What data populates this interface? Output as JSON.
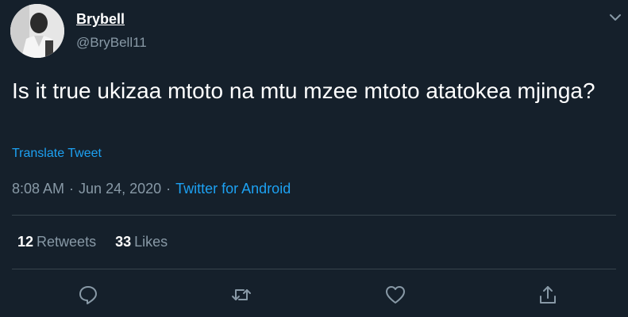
{
  "tweet": {
    "author": {
      "name": "Brybell",
      "handle": "@BryBell11",
      "avatar_icon": "profile-photo"
    },
    "text": "Is it true ukizaa mtoto na mtu mzee mtoto atatokea mjinga?",
    "translate_label": "Translate Tweet",
    "time": "8:08 AM",
    "date": "Jun 24, 2020",
    "separator": "·",
    "source": "Twitter for Android",
    "retweets": {
      "count": "12",
      "label": "Retweets"
    },
    "likes": {
      "count": "33",
      "label": "Likes"
    }
  },
  "actions": [
    {
      "name": "reply",
      "icon": "reply-icon"
    },
    {
      "name": "retweet",
      "icon": "retweet-icon"
    },
    {
      "name": "like",
      "icon": "heart-icon"
    },
    {
      "name": "share",
      "icon": "share-icon"
    }
  ],
  "colors": {
    "background": "#15202b",
    "text": "#ffffff",
    "secondary": "#8899a6",
    "link": "#1da1f2",
    "divider": "#38444d"
  }
}
